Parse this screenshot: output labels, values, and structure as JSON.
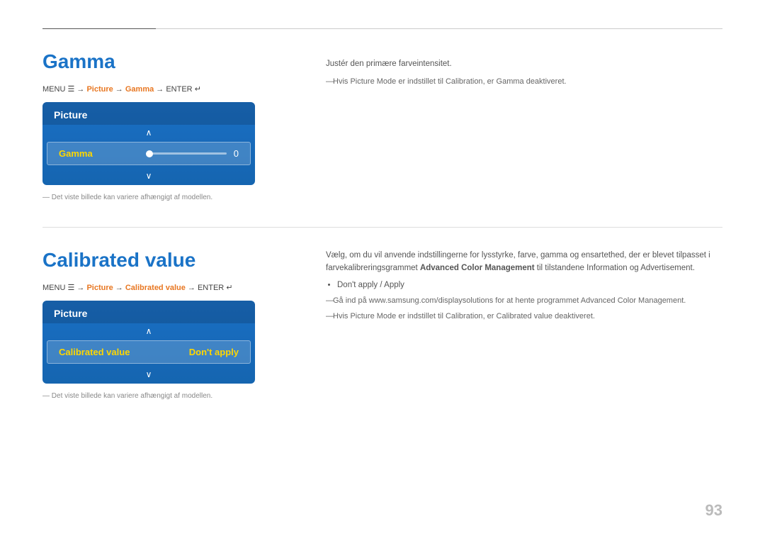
{
  "page": {
    "number": "93"
  },
  "top_divider": true,
  "sections": [
    {
      "id": "gamma",
      "title": "Gamma",
      "menu_path": {
        "prefix": "MENU",
        "symbol_menu": "☰",
        "arrow": "→",
        "item1": "Picture",
        "item2": "Gamma",
        "enter": "ENTER",
        "symbol_enter": "↵"
      },
      "tv_ui": {
        "header": "Picture",
        "arrow_up": "∧",
        "row_label": "Gamma",
        "slider": true,
        "row_value": "0",
        "arrow_down": "∨"
      },
      "note": "Det viste billede kan variere afhængigt af modellen.",
      "right": {
        "desc": "Justér den primære farveintensitet.",
        "dash_note": "Hvis ",
        "dash_note_bold_orange": "Picture Mode",
        "dash_note_middle": " er indstillet til ",
        "dash_note_bold_orange2": "Calibration",
        "dash_note_end": ", er ",
        "dash_note_bold_orange3": "Gamma",
        "dash_note_last": " deaktiveret."
      }
    },
    {
      "id": "calibrated-value",
      "title": "Calibrated value",
      "menu_path": {
        "prefix": "MENU",
        "symbol_menu": "☰",
        "arrow": "→",
        "item1": "Picture",
        "item2": "Calibrated value",
        "enter": "ENTER",
        "symbol_enter": "↵"
      },
      "tv_ui": {
        "header": "Picture",
        "arrow_up": "∧",
        "row_label": "Calibrated value",
        "row_value": "Don't apply",
        "arrow_down": "∨"
      },
      "note": "Det viste billede kan variere afhængigt af modellen.",
      "right": {
        "desc": "Vælg, om du vil anvende indstillingerne for lysstyrke, farve, gamma og ensartethed, der er blevet tilpasset i farvekalibreringsgrammet ",
        "desc_bold": "Advanced Color Management",
        "desc_end": " til tilstandene Information og Advertisement.",
        "bullet": {
          "text_orange": "Don't apply",
          "sep": " / ",
          "text_orange2": "Apply"
        },
        "dash1_pre": "Gå ind på www.samsung.com/displaysolutions for at hente programmet ",
        "dash1_bold": "Advanced Color Management",
        "dash1_end": ".",
        "dash2_pre": "Hvis ",
        "dash2_orange": "Picture Mode",
        "dash2_mid": " er indstillet til ",
        "dash2_orange2": "Calibration",
        "dash2_end": ", er ",
        "dash2_orange3": "Calibrated value",
        "dash2_last": " deaktiveret."
      }
    }
  ]
}
